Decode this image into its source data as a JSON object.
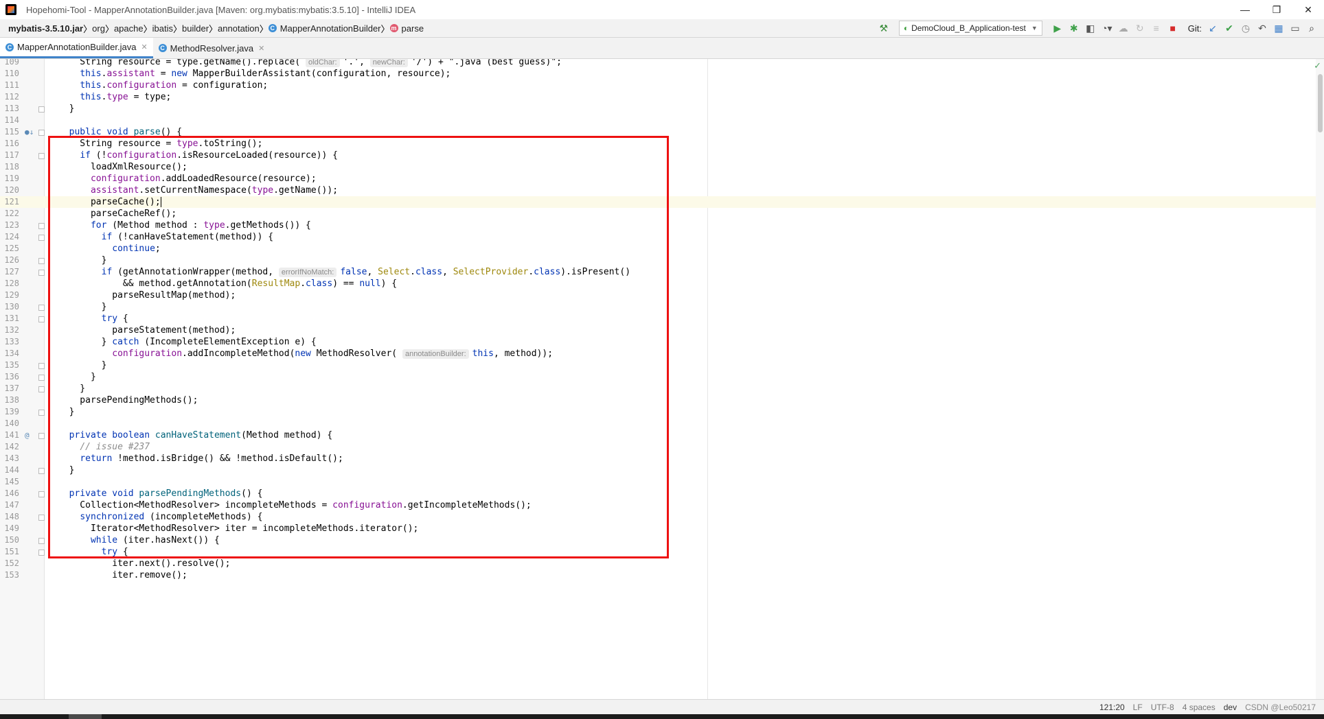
{
  "title": "Hopehomi-Tool - MapperAnnotationBuilder.java [Maven: org.mybatis:mybatis:3.5.10] - IntelliJ IDEA",
  "window_controls": [
    "—",
    "❐",
    "✕"
  ],
  "breadcrumbs": [
    {
      "label": "mybatis-3.5.10.jar",
      "bold": true
    },
    {
      "label": "org"
    },
    {
      "label": "apache"
    },
    {
      "label": "ibatis"
    },
    {
      "label": "builder"
    },
    {
      "label": "annotation"
    },
    {
      "label": "MapperAnnotationBuilder",
      "icon": "C"
    },
    {
      "label": "parse",
      "icon": "m"
    }
  ],
  "run_config": "DemoCloud_B_Application-test",
  "git_label": "Git:",
  "tabs": [
    {
      "label": "MapperAnnotationBuilder.java",
      "active": true
    },
    {
      "label": "MethodResolver.java",
      "active": false
    }
  ],
  "code_lines": [
    {
      "n": "109",
      "h": "    String resource = type.getName().replace( <span class='hint'>oldChar:</span>'.', <span class='hint'>newChar:</span>'/') + \".java (best guess)\";"
    },
    {
      "n": "110",
      "h": "    <span class='kw'>this</span>.<span class='fld'>assistant</span> = <span class='kw'>new</span> MapperBuilderAssistant(configuration, resource);"
    },
    {
      "n": "111",
      "h": "    <span class='kw'>this</span>.<span class='fld'>configuration</span> = configuration;"
    },
    {
      "n": "112",
      "h": "    <span class='kw'>this</span>.<span class='fld'>type</span> = type;"
    },
    {
      "n": "113",
      "h": "  }"
    },
    {
      "n": "114",
      "h": ""
    },
    {
      "n": "115",
      "h": "  <span class='kw'>public void</span> <span style='color:#00627a'>parse</span>() {",
      "mark": "●↓"
    },
    {
      "n": "116",
      "h": "    String resource = <span class='fld'>type</span>.toString();"
    },
    {
      "n": "117",
      "h": "    <span class='kw'>if</span> (!<span class='fld'>configuration</span>.isResourceLoaded(resource)) {"
    },
    {
      "n": "118",
      "h": "      loadXmlResource();"
    },
    {
      "n": "119",
      "h": "      <span class='fld'>configuration</span>.addLoadedResource(resource);"
    },
    {
      "n": "120",
      "h": "      <span class='fld'>assistant</span>.setCurrentNamespace(<span class='fld'>type</span>.getName());"
    },
    {
      "n": "121",
      "h": "      parseCache();<span class='caret'></span>",
      "current": true
    },
    {
      "n": "122",
      "h": "      parseCacheRef();"
    },
    {
      "n": "123",
      "h": "      <span class='kw'>for</span> (Method method : <span class='fld'>type</span>.getMethods()) {"
    },
    {
      "n": "124",
      "h": "        <span class='kw'>if</span> (!canHaveStatement(method)) {"
    },
    {
      "n": "125",
      "h": "          <span class='kw'>continue</span>;"
    },
    {
      "n": "126",
      "h": "        }"
    },
    {
      "n": "127",
      "h": "        <span class='kw'>if</span> (getAnnotationWrapper(method, <span class='hint'>errorIfNoMatch:</span><span class='kw'>false</span>, <span class='cls'>Select</span>.<span class='kw'>class</span>, <span class='cls'>SelectProvider</span>.<span class='kw'>class</span>).isPresent()"
    },
    {
      "n": "128",
      "h": "            &amp;&amp; method.getAnnotation(<span class='cls'>ResultMap</span>.<span class='kw'>class</span>) == <span class='kw'>null</span>) {"
    },
    {
      "n": "129",
      "h": "          parseResultMap(method);"
    },
    {
      "n": "130",
      "h": "        }"
    },
    {
      "n": "131",
      "h": "        <span class='kw'>try</span> {"
    },
    {
      "n": "132",
      "h": "          parseStatement(method);"
    },
    {
      "n": "133",
      "h": "        } <span class='kw'>catch</span> (IncompleteElementException e) {"
    },
    {
      "n": "134",
      "h": "          <span class='fld'>configuration</span>.addIncompleteMethod(<span class='kw'>new</span> MethodResolver( <span class='hint'>annotationBuilder:</span><span class='kw'>this</span>, method));"
    },
    {
      "n": "135",
      "h": "        }"
    },
    {
      "n": "136",
      "h": "      }"
    },
    {
      "n": "137",
      "h": "    }"
    },
    {
      "n": "138",
      "h": "    parsePendingMethods();"
    },
    {
      "n": "139",
      "h": "  }"
    },
    {
      "n": "140",
      "h": ""
    },
    {
      "n": "141",
      "h": "  <span class='kw'>private boolean</span> <span style='color:#00627a'>canHaveStatement</span>(Method method) {",
      "mark": "@"
    },
    {
      "n": "142",
      "h": "    <span class='cmt'>// issue #237</span>"
    },
    {
      "n": "143",
      "h": "    <span class='kw'>return</span> !method.isBridge() &amp;&amp; !method.isDefault();"
    },
    {
      "n": "144",
      "h": "  }"
    },
    {
      "n": "145",
      "h": ""
    },
    {
      "n": "146",
      "h": "  <span class='kw'>private void</span> <span style='color:#00627a'>parsePendingMethods</span>() {"
    },
    {
      "n": "147",
      "h": "    Collection&lt;MethodResolver&gt; incompleteMethods = <span class='fld'>configuration</span>.getIncompleteMethods();"
    },
    {
      "n": "148",
      "h": "    <span class='kw'>synchronized</span> (incompleteMethods) {"
    },
    {
      "n": "149",
      "h": "      Iterator&lt;MethodResolver&gt; iter = incompleteMethods.iterator();"
    },
    {
      "n": "150",
      "h": "      <span class='kw'>while</span> (iter.hasNext()) {"
    },
    {
      "n": "151",
      "h": "        <span class='kw'>try</span> {"
    },
    {
      "n": "152",
      "h": "          iter.next().resolve();"
    },
    {
      "n": "153",
      "h": "          iter.remove();"
    }
  ],
  "status": {
    "position": "121:20",
    "line_sep": "LF",
    "encoding": "UTF-8",
    "indent": "4 spaces",
    "branch": "dev",
    "watermark": "CSDN @Leo50217"
  }
}
